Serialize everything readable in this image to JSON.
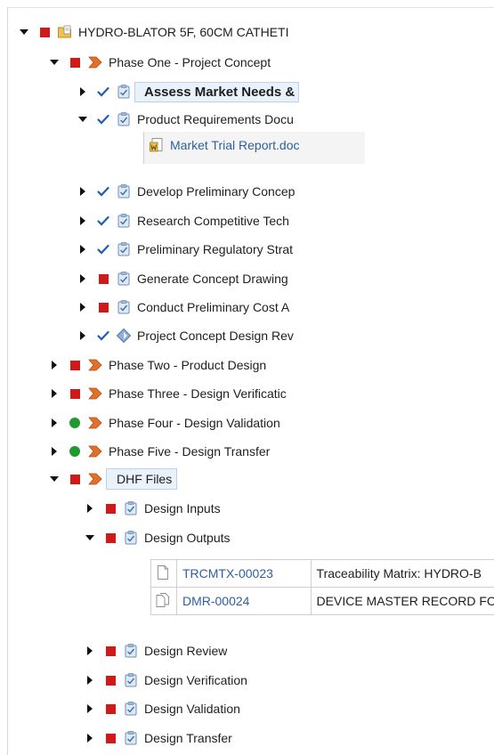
{
  "tree": {
    "root": {
      "label": "HYDRO-BLATOR 5F, 60CM CATHETI",
      "status": "red",
      "icon": "project-folder-icon",
      "expanded": true
    },
    "phase_one": {
      "label": "Phase One - Project Concept",
      "status": "red",
      "icon": "phase-arrow-icon",
      "expanded": true,
      "tasks": [
        {
          "label": "Assess Market Needs &",
          "status": "check",
          "expanded": false,
          "bold": true
        },
        {
          "label": "Product Requirements Docu",
          "status": "check",
          "expanded": true,
          "attachment": {
            "label": "Market Trial Report.doc",
            "icon": "word-document-icon"
          }
        },
        {
          "label": "Develop Preliminary Concep",
          "status": "check",
          "expanded": false
        },
        {
          "label": "Research Competitive Tech",
          "status": "check",
          "expanded": false
        },
        {
          "label": "Preliminary Regulatory Strat",
          "status": "check",
          "expanded": false
        },
        {
          "label": "Generate Concept Drawing",
          "status": "red",
          "expanded": false
        },
        {
          "label": "Conduct Preliminary Cost A",
          "status": "red",
          "expanded": false
        },
        {
          "label": "Project Concept Design Rev",
          "status": "check",
          "expanded": false,
          "icon": "milestone-diamond-icon"
        }
      ]
    },
    "phases": [
      {
        "label": "Phase Two - Product Design",
        "status": "red"
      },
      {
        "label": "Phase Three - Design Verificatic",
        "status": "red"
      },
      {
        "label": "Phase Four - Design Validation",
        "status": "green"
      },
      {
        "label": "Phase Five - Design Transfer",
        "status": "green"
      }
    ],
    "dhf": {
      "label": "DHF Files",
      "status": "red",
      "expanded": true,
      "children": [
        {
          "label": "Design Inputs",
          "status": "red",
          "expanded": false
        },
        {
          "label": "Design Outputs",
          "status": "red",
          "expanded": true,
          "documents": [
            {
              "id": "TRCMTX-00023",
              "description": "Traceability Matrix: HYDRO-B"
            },
            {
              "id": "DMR-00024",
              "description": "DEVICE MASTER RECORD FC"
            }
          ]
        },
        {
          "label": "Design Review",
          "status": "red",
          "expanded": false
        },
        {
          "label": "Design Verification",
          "status": "red",
          "expanded": false
        },
        {
          "label": "Design Validation",
          "status": "red",
          "expanded": false
        },
        {
          "label": "Design Transfer",
          "status": "red",
          "expanded": false
        }
      ]
    }
  },
  "colors": {
    "status_red": "#d01a1a",
    "status_green": "#1f9a2f",
    "check_blue": "#1f5fb3",
    "phase_orange": "#e2702a",
    "link_blue": "#2f5f9e"
  }
}
